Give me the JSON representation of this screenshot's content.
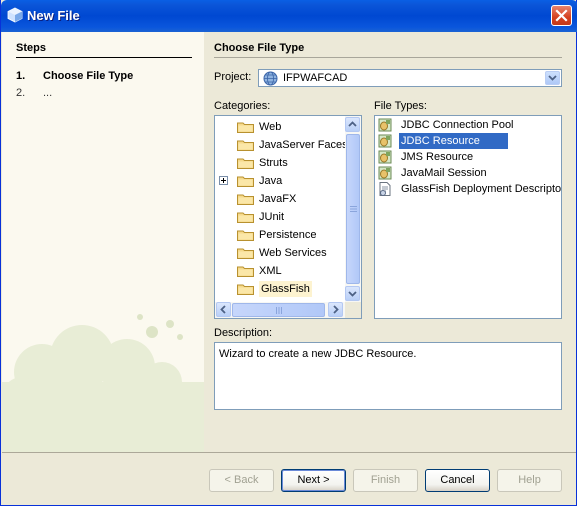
{
  "window": {
    "title": "New File"
  },
  "steps": {
    "heading": "Steps",
    "items": [
      {
        "num": "1.",
        "label": "Choose File Type"
      },
      {
        "num": "2.",
        "label": "..."
      }
    ]
  },
  "main": {
    "heading": "Choose File Type",
    "project_label": "Project:",
    "project_value": "IFPWAFCAD",
    "categories_label": "Categories:",
    "categories": [
      "Web",
      "JavaServer Faces",
      "Struts",
      "Java",
      "JavaFX",
      "JUnit",
      "Persistence",
      "Web Services",
      "XML",
      "GlassFish"
    ],
    "file_types_label": "File Types:",
    "file_types": [
      "JDBC Connection Pool",
      "JDBC Resource",
      "JMS Resource",
      "JavaMail Session",
      "GlassFish Deployment Descriptor"
    ],
    "description_label": "Description:",
    "description_text": "Wizard to create a new JDBC Resource."
  },
  "buttons": {
    "back": "< Back",
    "next": "Next >",
    "finish": "Finish",
    "cancel": "Cancel",
    "help": "Help"
  },
  "colors": {
    "selection": "#316ac5",
    "titlebar": "#0048d2"
  }
}
